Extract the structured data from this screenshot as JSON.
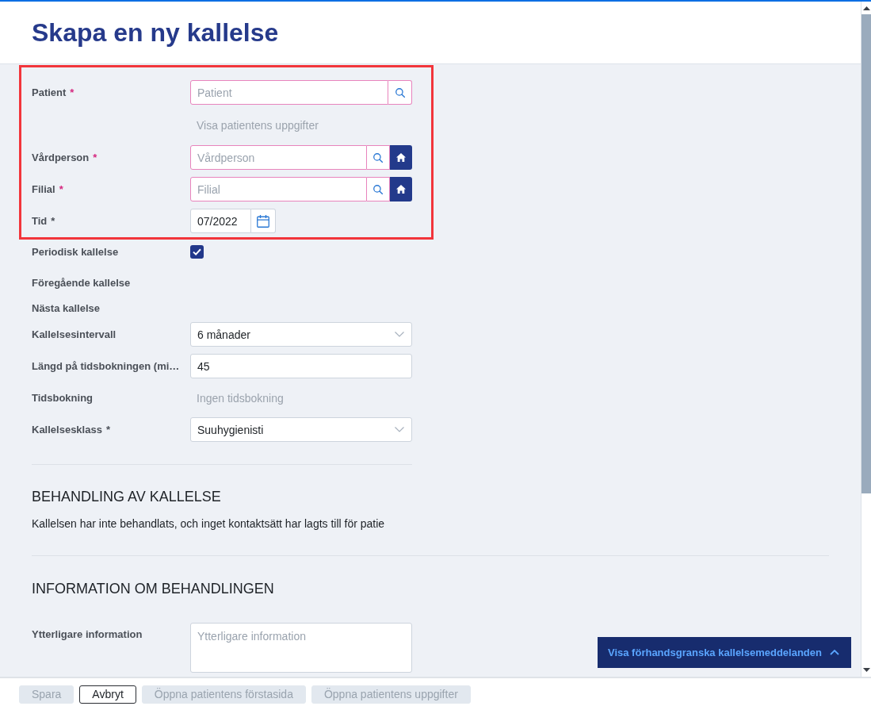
{
  "header": {
    "title": "Skapa en ny kallelse"
  },
  "form": {
    "groups": [
      {
        "highlighted": true,
        "rows": [
          {
            "kind": "search",
            "label": "Patient",
            "marker": "*",
            "invalid": true,
            "placeholder": "Patient",
            "home_button": false
          },
          {
            "kind": "link",
            "text": "Visa patientens uppgifter",
            "disabled": true
          },
          {
            "kind": "search",
            "label": "Vårdperson",
            "marker": "*",
            "invalid": true,
            "placeholder": "Vårdperson",
            "home_button": true
          },
          {
            "kind": "search",
            "label": "Filial",
            "marker": "*",
            "invalid": true,
            "placeholder": "Filial",
            "home_button": true
          },
          {
            "kind": "date",
            "label": "Tid",
            "marker": "*",
            "invalid": false,
            "value": "07/2022"
          }
        ]
      },
      {
        "highlighted": false,
        "rows": [
          {
            "kind": "checkbox",
            "label": "Periodisk kallelse",
            "checked": true
          },
          {
            "kind": "text",
            "label": "Föregående kallelse"
          },
          {
            "kind": "text",
            "label": "Nästa kallelse"
          },
          {
            "kind": "select",
            "label": "Kallelsesintervall",
            "invalid": false,
            "value": "6 månader"
          },
          {
            "kind": "input",
            "label": "Längd på tidsbokningen (mi…",
            "invalid": false,
            "value": "45"
          },
          {
            "kind": "text",
            "label": "Tidsbokning",
            "value": "Ingen tidsbokning"
          },
          {
            "kind": "select",
            "label": "Kallelsesklass",
            "marker": "*",
            "invalid": false,
            "value": "Suuhygienisti"
          }
        ]
      }
    ]
  },
  "sections": [
    {
      "heading": "BEHANDLING AV KALLELSE",
      "text": "Kallelsen har inte behandlats, och inget kontaktsätt har lagts till för patie"
    },
    {
      "heading": "INFORMATION OM BEHANDLINGEN",
      "rows": [
        {
          "kind": "textarea",
          "label": "Ytterligare information",
          "invalid": false,
          "placeholder": "Ytterligare information"
        }
      ]
    }
  ],
  "preview_button": {
    "label": "Visa förhandsgranska kallelsemeddelanden",
    "expanded": false
  },
  "footer": {
    "buttons": [
      {
        "label": "Spara",
        "disabled": true
      },
      {
        "label": "Avbryt",
        "disabled": false
      },
      {
        "label": "Öppna patientens förstasida",
        "disabled": true
      },
      {
        "label": "Öppna patientens uppgifter",
        "disabled": true
      }
    ]
  }
}
